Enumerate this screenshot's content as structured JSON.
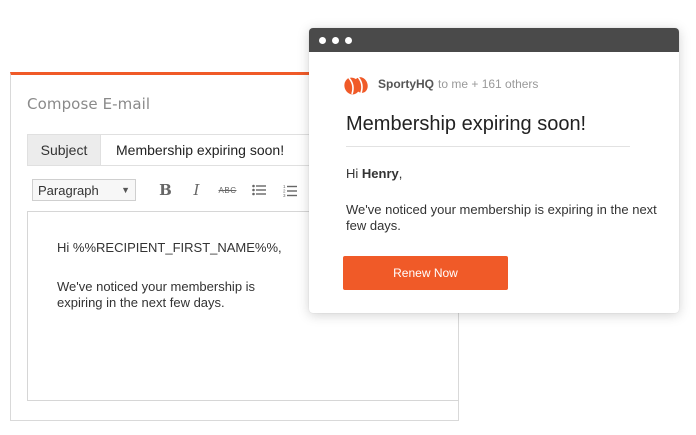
{
  "compose": {
    "title": "Compose E-mail",
    "subject_label": "Subject",
    "subject_value": "Membership expiring soon!",
    "toolbar": {
      "format_select": "Paragraph",
      "buttons": [
        "bold-icon",
        "italic-icon",
        "strikethrough-icon",
        "bullet-list-icon",
        "numbered-list-icon"
      ],
      "strike_label": "ABC"
    },
    "editor": {
      "greeting": "Hi %%RECIPIENT_FIRST_NAME%%,",
      "body": "We've noticed your membership is expiring in the next few days."
    },
    "accent_color": "#f05a28"
  },
  "preview": {
    "sender": "SportyHQ",
    "recipients": "to me + 161 others",
    "subject": "Membership expiring soon!",
    "greeting_prefix": "Hi ",
    "greeting_name": "Henry",
    "greeting_suffix": ",",
    "body": "We've noticed your membership is expiring in the next few days.",
    "button_label": "Renew Now",
    "button_color": "#f05a28",
    "titlebar_color": "#4a4a4a"
  }
}
